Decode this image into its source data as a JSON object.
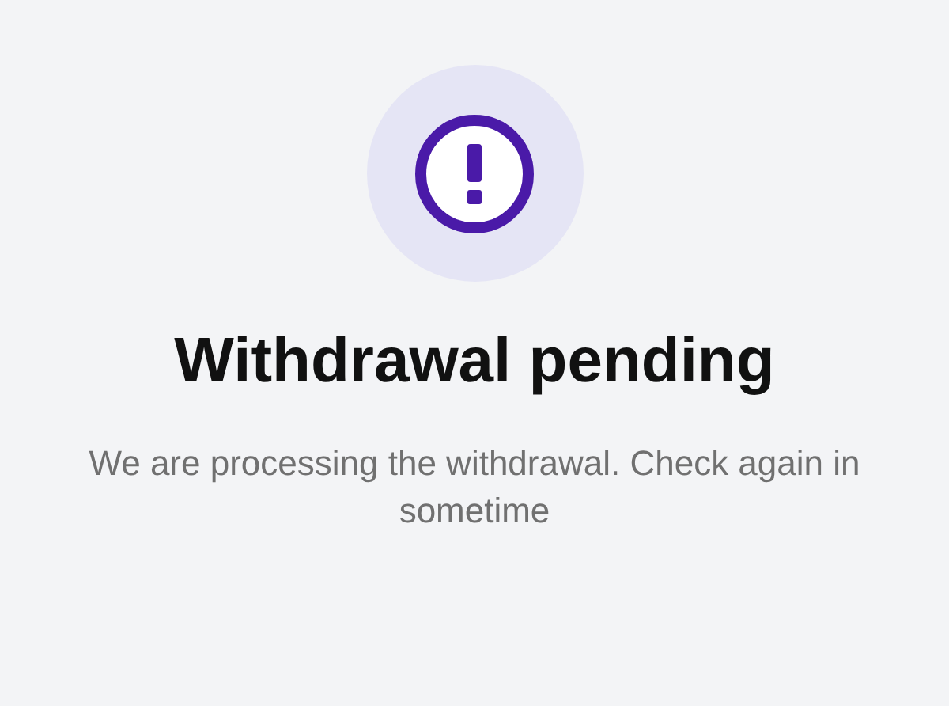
{
  "title": "Withdrawal pending",
  "message": "We are processing the withdrawal. Check again in sometime"
}
